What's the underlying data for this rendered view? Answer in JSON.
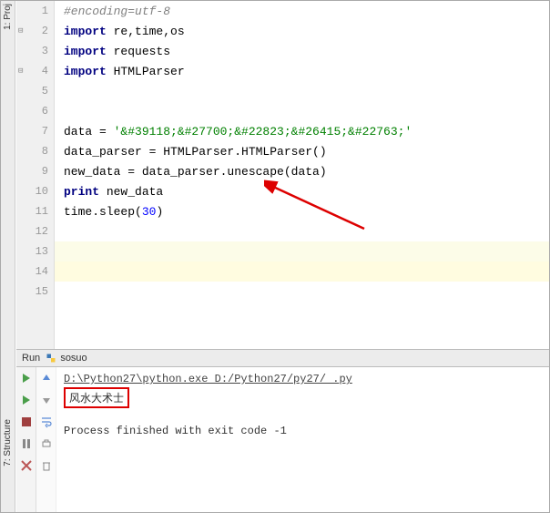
{
  "rail": {
    "proj": "1: Proj",
    "struct": "7: Structure"
  },
  "gutter": [
    "1",
    "2",
    "3",
    "4",
    "5",
    "6",
    "7",
    "8",
    "9",
    "10",
    "11",
    "12",
    "13",
    "14",
    "15"
  ],
  "code": {
    "comment": "#encoding=utf-8",
    "kw_import": "import",
    "l2_mods": " re,time,os",
    "l3_mods": " requests",
    "l4_mods": " HTMLParser",
    "l7_a": "data = ",
    "l7_b": "'&#39118;&#27700;&#22823;&#26415;&#22763;'",
    "l8": "data_parser = HTMLParser.HTMLParser()",
    "l9": "new_data = data_parser.unescape(data)",
    "kw_print": "print",
    "l10_b": " new_data",
    "l11_a": "time.sleep(",
    "l11_b": "30",
    "l11_c": ")"
  },
  "run": {
    "label": "Run",
    "name": "sosuo"
  },
  "console": {
    "path": "D:\\Python27\\python.exe D:/Python27/py27/      .py",
    "output": "风水大术士",
    "exit": "Process finished with exit code -1"
  }
}
